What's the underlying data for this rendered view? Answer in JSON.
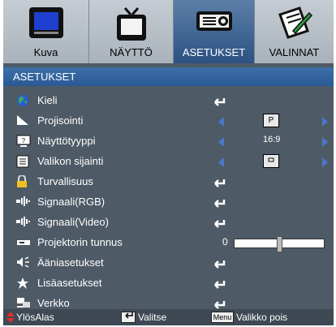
{
  "tabs": [
    {
      "label": "Kuva",
      "icon": "display-icon"
    },
    {
      "label": "NÄYTTÖ",
      "icon": "tv-icon"
    },
    {
      "label": "ASETUKSET",
      "icon": "projector-icon",
      "active": true
    },
    {
      "label": "VALINNAT",
      "icon": "document-pen-icon"
    }
  ],
  "header": {
    "title": "ASETUKSET"
  },
  "rows": [
    {
      "label": "Kieli",
      "icon": "globe-icon",
      "control": "enter"
    },
    {
      "label": "Projisointi",
      "icon": "projection-icon",
      "control": "select",
      "value": "P"
    },
    {
      "label": "Näyttötyyppi",
      "icon": "screen-type-icon",
      "control": "select",
      "value": "16:9"
    },
    {
      "label": "Valikon sijainti",
      "icon": "menu-location-icon",
      "control": "select",
      "value": "center"
    },
    {
      "label": "Turvallisuus",
      "icon": "lock-icon",
      "control": "enter"
    },
    {
      "label": "Signaali(RGB)",
      "icon": "signal-icon",
      "control": "enter"
    },
    {
      "label": "Signaali(Video)",
      "icon": "signal-icon",
      "control": "enter"
    },
    {
      "label": "Projektorin tunnus",
      "icon": "projector-id-icon",
      "control": "slider",
      "value": "0",
      "level": 0.5
    },
    {
      "label": "Ääniasetukset",
      "icon": "speaker-icon",
      "control": "enter"
    },
    {
      "label": "Lisäasetukset",
      "icon": "star-icon",
      "control": "enter"
    },
    {
      "label": "Verkko",
      "icon": "network-icon",
      "control": "enter"
    }
  ],
  "footer": {
    "updown": "YlösAlas",
    "select": "Valitse",
    "menu_key": "Menu",
    "exit": "Valikko pois"
  },
  "colors": {
    "accent": "#2c5283",
    "panel": "#4e5a66",
    "arrow": "#4a78c8"
  }
}
